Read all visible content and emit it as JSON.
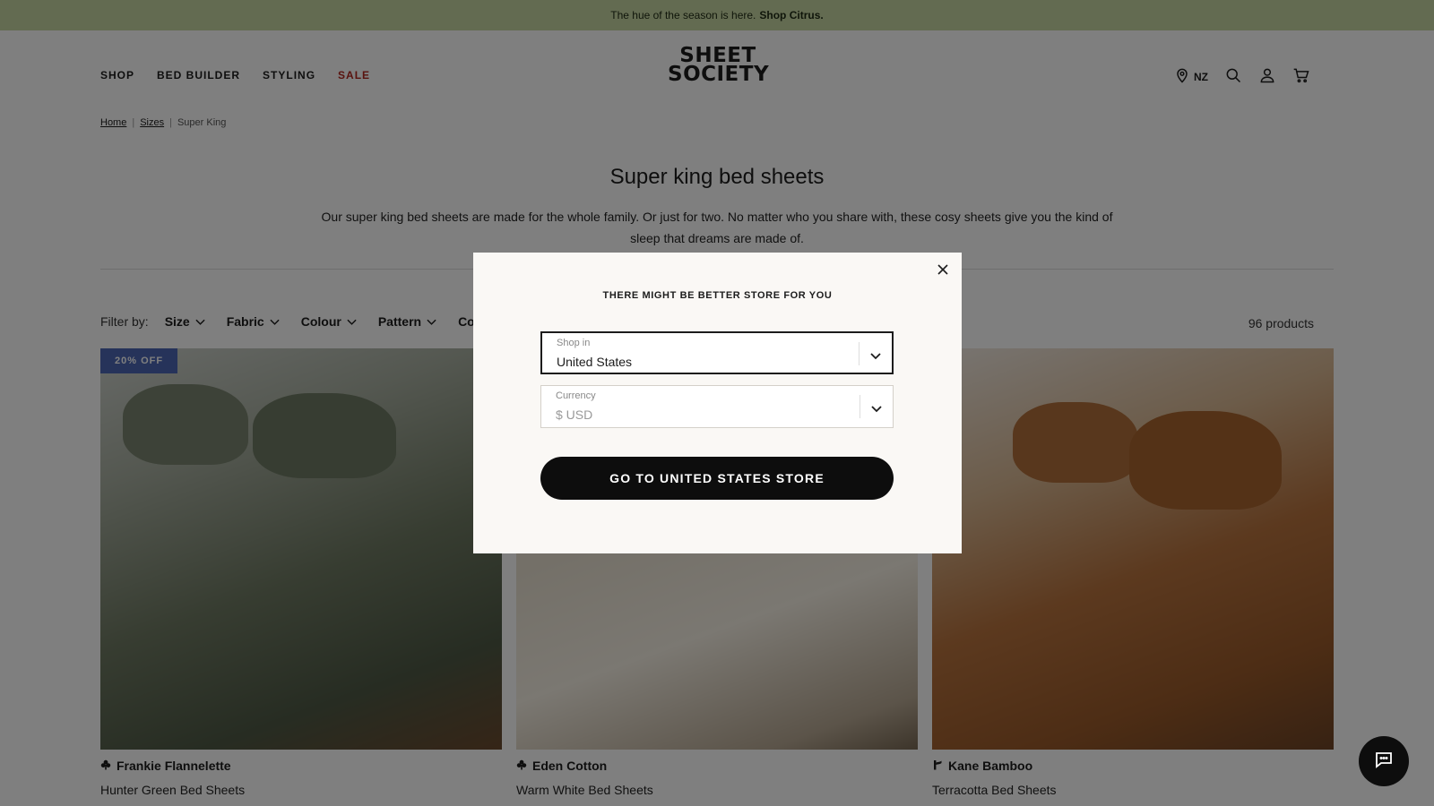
{
  "announcement": {
    "text": "The hue of the season is here.",
    "link": "Shop Citrus."
  },
  "header": {
    "nav": [
      "SHOP",
      "BED BUILDER",
      "STYLING",
      "SALE"
    ],
    "logo_line1": "SHEET",
    "logo_line2": "SOCIETY",
    "region": "NZ"
  },
  "breadcrumb": {
    "home": "Home",
    "sizes": "Sizes",
    "current": "Super King"
  },
  "page": {
    "title": "Super king bed sheets",
    "description": "Our super king bed sheets are made for the whole family. Or just for two. No matter who you share with, these cosy sheets give you the kind of sleep that dreams are made of."
  },
  "filters": {
    "label": "Filter by:",
    "items": [
      "Size",
      "Fabric",
      "Colour",
      "Pattern",
      "Co"
    ],
    "count": "96 products"
  },
  "products": [
    {
      "badge": "20% OFF",
      "brand": "Frankie Flannelette",
      "name": "Hunter Green Bed Sheets",
      "icon": "club-icon"
    },
    {
      "badge": "",
      "brand": "Eden Cotton",
      "name": "Warm White Bed Sheets",
      "icon": "club-icon"
    },
    {
      "badge": "",
      "brand": "Kane Bamboo",
      "name": "Terracotta Bed Sheets",
      "icon": "bamboo-icon"
    }
  ],
  "modal": {
    "title": "THERE MIGHT BE BETTER STORE FOR YOU",
    "shop_label": "Shop in",
    "shop_value": "United States",
    "currency_label": "Currency",
    "currency_value": "$ USD",
    "button": "GO TO UNITED STATES STORE"
  },
  "colors": {
    "announcement_bg": "#c7d6a2",
    "sale": "#b3261e",
    "badge": "#4d67b5",
    "button": "#0d0d0d"
  }
}
